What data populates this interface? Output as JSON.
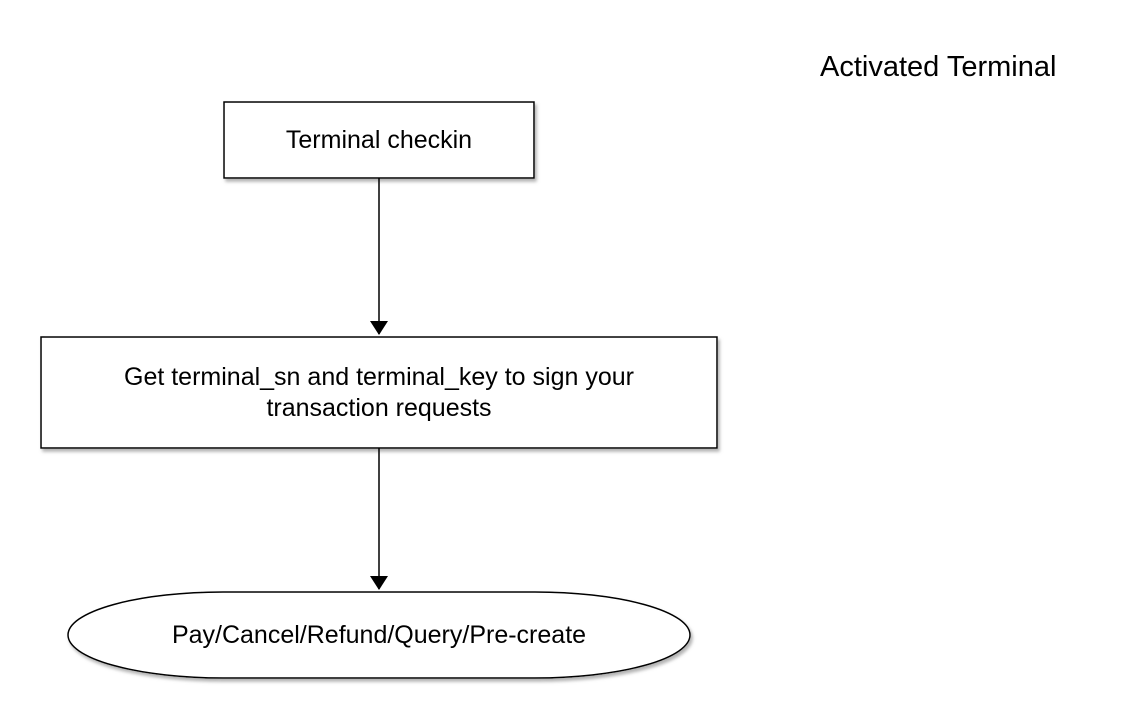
{
  "diagram": {
    "title": "Activated Terminal",
    "nodes": [
      {
        "id": "checkin",
        "shape": "rectangle",
        "label": "Terminal checkin"
      },
      {
        "id": "get-keys",
        "shape": "rectangle",
        "label": "Get terminal_sn and terminal_key to sign your transaction requests"
      },
      {
        "id": "transactions",
        "shape": "terminator",
        "label": "Pay/Cancel/Refund/Query/Pre-create"
      }
    ],
    "edges": [
      {
        "from": "checkin",
        "to": "get-keys"
      },
      {
        "from": "get-keys",
        "to": "transactions"
      }
    ],
    "colors": {
      "stroke": "#000000",
      "fill": "#ffffff",
      "shadow": "#9a9a9a"
    }
  }
}
